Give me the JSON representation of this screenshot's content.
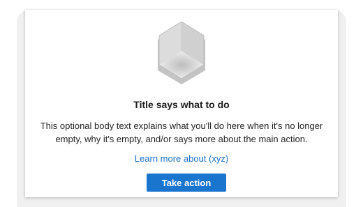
{
  "empty_state": {
    "illustration_icon": "empty-box-icon",
    "title": "Title says what to do",
    "body": "This optional body text explains what you'll do here when it's no longer empty, why it's empty, and/or says more about the main action.",
    "link_label": "Learn more about (xyz)",
    "action_label": "Take action"
  },
  "colors": {
    "accent": "#1a75cf",
    "link": "#1a6fc9",
    "panel_background": "#f0f0f0"
  }
}
